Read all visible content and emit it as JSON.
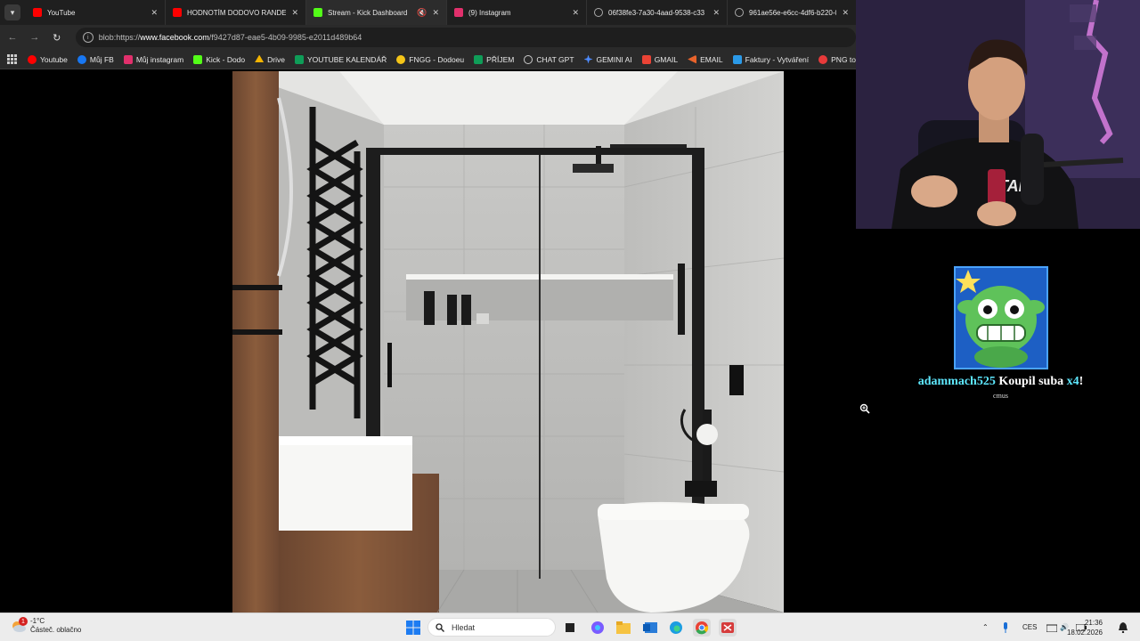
{
  "browser": {
    "tabs": [
      {
        "title": "YouTube",
        "favicon_color": "#ff0000"
      },
      {
        "title": "HODNOTÍM DODOVO RANDE!",
        "favicon_color": "#ff0000"
      },
      {
        "title": "Stream - Kick Dashboard",
        "favicon_color": "#53fc18"
      },
      {
        "title": "(9) Instagram",
        "favicon_color": "#e1306c"
      },
      {
        "title": "06f38fe3-7a30-4aad-9538-c33",
        "favicon_color": "#999999"
      },
      {
        "title": "961ae56e-e6cc-4df6-b220-04...",
        "favicon_color": "#999999"
      }
    ],
    "url_prefix": "blob:https://",
    "url_host": "www.facebook.com",
    "url_path": "/f9427d87-eae5-4b09-9985-e2011d489b64",
    "bookmarks": [
      {
        "label": "Youtube",
        "color": "#ff0000"
      },
      {
        "label": "Můj FB",
        "color": "#1877f2"
      },
      {
        "label": "Můj instagram",
        "color": "#e1306c"
      },
      {
        "label": "Kick - Dodo",
        "color": "#53fc18"
      },
      {
        "label": "Drive",
        "color": "#f4b400"
      },
      {
        "label": "YOUTUBE KALENDÁŘ",
        "color": "#0f9d58"
      },
      {
        "label": "FNGG - Dodoeu",
        "color": "#f5c518"
      },
      {
        "label": "PŘÍJEM",
        "color": "#0f9d58"
      },
      {
        "label": "CHAT GPT",
        "color": "#cccccc"
      },
      {
        "label": "GEMINI AI",
        "color": "#4e8cff"
      },
      {
        "label": "GMAIL",
        "color": "#ea4335"
      },
      {
        "label": "EMAIL",
        "color": "#e8632b"
      },
      {
        "label": "Faktury - Vytváření",
        "color": "#2b9ae8"
      },
      {
        "label": "PNG to PDF",
        "color": "#e83a3a"
      }
    ]
  },
  "alert": {
    "username": "adammach525",
    "action": "Koupil suba",
    "multiplier": "x4",
    "exclaim": "!",
    "message": "cmus"
  },
  "taskbar": {
    "weather_badge": "1",
    "temperature": "-1°C",
    "weather_desc": "Částeč. oblačno",
    "search_placeholder": "Hledat",
    "language": "CES",
    "time": "21:36",
    "date": "18.02.2026"
  }
}
